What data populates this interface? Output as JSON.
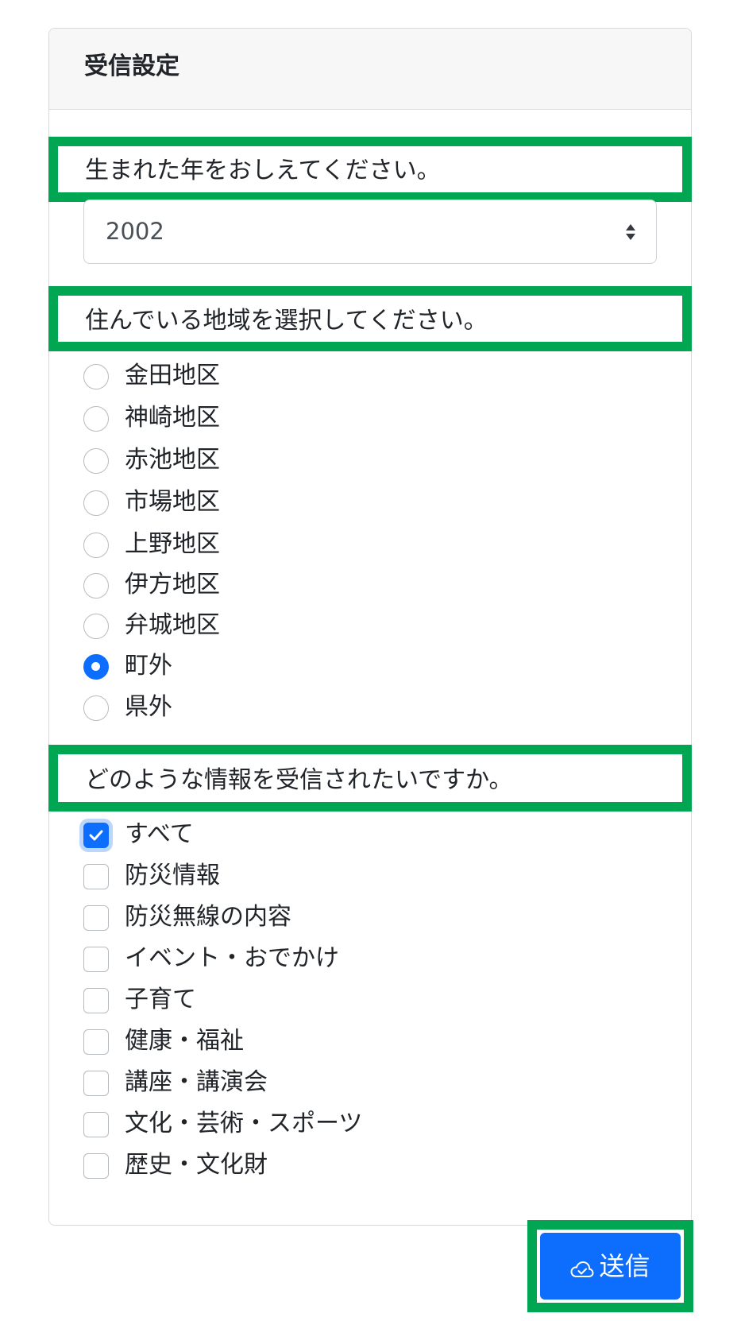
{
  "card": {
    "title": "受信設定"
  },
  "birth_year": {
    "question": "生まれた年をおしえてください。",
    "selected": "2002"
  },
  "region": {
    "question": "住んでいる地域を選択してください。",
    "options": [
      {
        "label": "金田地区",
        "checked": false
      },
      {
        "label": "神崎地区",
        "checked": false
      },
      {
        "label": "赤池地区",
        "checked": false
      },
      {
        "label": "市場地区",
        "checked": false
      },
      {
        "label": "上野地区",
        "checked": false
      },
      {
        "label": "伊方地区",
        "checked": false
      },
      {
        "label": "弁城地区",
        "checked": false
      },
      {
        "label": "町外",
        "checked": true
      },
      {
        "label": "県外",
        "checked": false
      }
    ]
  },
  "info": {
    "question": "どのような情報を受信されたいですか。",
    "options": [
      {
        "label": "すべて",
        "checked": true
      },
      {
        "label": "防災情報",
        "checked": false
      },
      {
        "label": "防災無線の内容",
        "checked": false
      },
      {
        "label": "イベント・おでかけ",
        "checked": false
      },
      {
        "label": "子育て",
        "checked": false
      },
      {
        "label": "健康・福祉",
        "checked": false
      },
      {
        "label": "講座・講演会",
        "checked": false
      },
      {
        "label": "文化・芸術・スポーツ",
        "checked": false
      },
      {
        "label": "歴史・文化財",
        "checked": false
      }
    ]
  },
  "submit": {
    "label": "送信",
    "icon": "cloud-check-icon"
  },
  "colors": {
    "accent": "#0d6efd",
    "highlight": "#00a651",
    "header_bg": "#f7f7f7"
  }
}
